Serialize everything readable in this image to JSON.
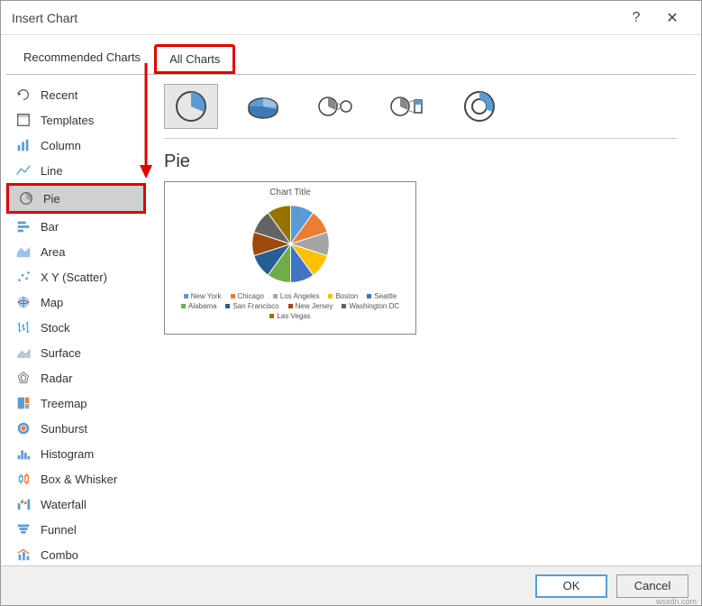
{
  "titlebar": {
    "title": "Insert Chart"
  },
  "tabs": {
    "recommended": "Recommended Charts",
    "all": "All Charts"
  },
  "sidebar": {
    "items": [
      {
        "label": "Recent",
        "icon": "recent-icon"
      },
      {
        "label": "Templates",
        "icon": "templates-icon"
      },
      {
        "label": "Column",
        "icon": "column-icon"
      },
      {
        "label": "Line",
        "icon": "line-icon"
      },
      {
        "label": "Pie",
        "icon": "pie-icon"
      },
      {
        "label": "Bar",
        "icon": "bar-icon"
      },
      {
        "label": "Area",
        "icon": "area-icon"
      },
      {
        "label": "X Y (Scatter)",
        "icon": "scatter-icon"
      },
      {
        "label": "Map",
        "icon": "map-icon"
      },
      {
        "label": "Stock",
        "icon": "stock-icon"
      },
      {
        "label": "Surface",
        "icon": "surface-icon"
      },
      {
        "label": "Radar",
        "icon": "radar-icon"
      },
      {
        "label": "Treemap",
        "icon": "treemap-icon"
      },
      {
        "label": "Sunburst",
        "icon": "sunburst-icon"
      },
      {
        "label": "Histogram",
        "icon": "histogram-icon"
      },
      {
        "label": "Box & Whisker",
        "icon": "box-icon"
      },
      {
        "label": "Waterfall",
        "icon": "waterfall-icon"
      },
      {
        "label": "Funnel",
        "icon": "funnel-icon"
      },
      {
        "label": "Combo",
        "icon": "combo-icon"
      }
    ]
  },
  "subtypes": {
    "names": [
      "pie",
      "3d-pie",
      "pie-of-pie",
      "bar-of-pie",
      "doughnut"
    ]
  },
  "preview": {
    "chart_name": "Pie",
    "title": "Chart Title"
  },
  "chart_data": {
    "type": "pie",
    "title": "Chart Title",
    "categories": [
      "New York",
      "Chicago",
      "Los Angeles",
      "Boston",
      "Seattle",
      "Alabama",
      "San Francisco",
      "New Jersey",
      "Washington DC",
      "Las Vegas"
    ],
    "values": [
      10,
      10,
      10,
      10,
      10,
      10,
      10,
      10,
      10,
      10
    ],
    "colors": [
      "#5b9bd5",
      "#ed7d31",
      "#a5a5a5",
      "#ffc000",
      "#4472c4",
      "#70ad47",
      "#255e91",
      "#9e480e",
      "#636363",
      "#997300"
    ]
  },
  "footer": {
    "ok": "OK",
    "cancel": "Cancel"
  },
  "watermark": "wsxdn.com"
}
